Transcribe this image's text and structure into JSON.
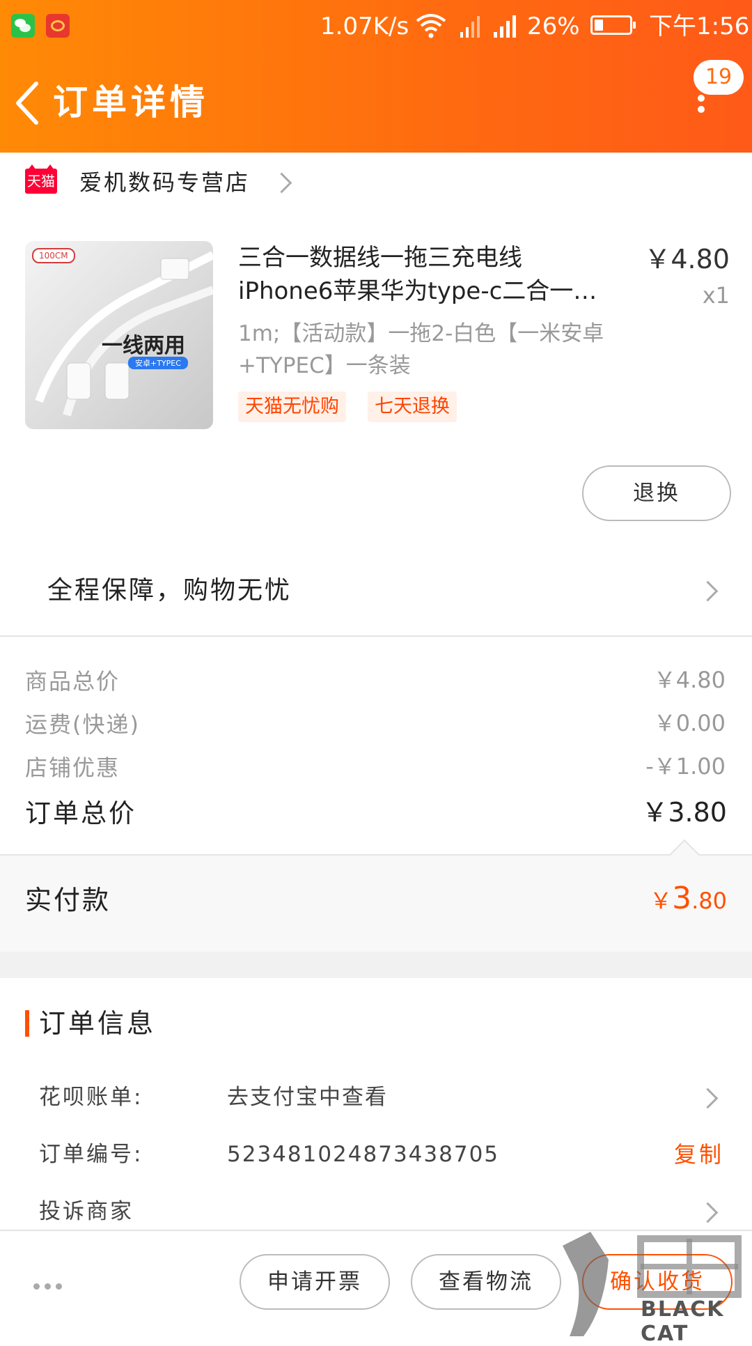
{
  "status_bar": {
    "speed": "1.07K/s",
    "battery": "26%",
    "battery_level": 0.26,
    "time": "下午1:56",
    "icons": [
      "wechat-icon",
      "weibo-icon",
      "wifi-icon",
      "signal-icon",
      "battery-icon"
    ]
  },
  "header": {
    "title": "订单详情",
    "badge_count": "19",
    "background_color": "#ff7a0c"
  },
  "store": {
    "logo_text": "天猫",
    "name": "爱机数码专营店"
  },
  "product": {
    "thumb_size_tag": "100CM",
    "thumb_text": "一线两用",
    "thumb_sub": "安卓+TYPEC",
    "title_line1": "三合一数据线一拖三充电线",
    "title_line2": "iPhone6苹果华为type-c二合一…",
    "price": "￥4.80",
    "qty": "x1",
    "sku": "1m;【活动款】一拖2-白色【一米安卓+TYPEC】一条装",
    "tags": [
      "天猫无忧购",
      "七天退换"
    ],
    "return_button": "退换"
  },
  "guarantee": {
    "text": "全程保障，购物无忧"
  },
  "pricing": {
    "rows": [
      {
        "label": "商品总价",
        "value": "￥4.80"
      },
      {
        "label": "运费(快递)",
        "value": "￥0.00"
      },
      {
        "label": "店铺优惠",
        "value": "-￥1.00"
      }
    ],
    "total_label": "订单总价",
    "total_value": "￥3.80",
    "paid_label": "实付款",
    "paid_currency": "￥",
    "paid_int": "3",
    "paid_dec": ".80",
    "accent_color": "#ff5000"
  },
  "order_info": {
    "title": "订单信息",
    "huabei_label": "花呗账单:",
    "huabei_value": "去支付宝中查看",
    "order_no_label": "订单编号:",
    "order_no_value": "523481024873438705",
    "copy_label": "复制",
    "complain_label": "投诉商家"
  },
  "bottom_bar": {
    "invoice_button": "申请开票",
    "logistics_button": "查看物流",
    "confirm_button": "确认收货"
  },
  "watermark": {
    "text": "BLACK CAT"
  }
}
